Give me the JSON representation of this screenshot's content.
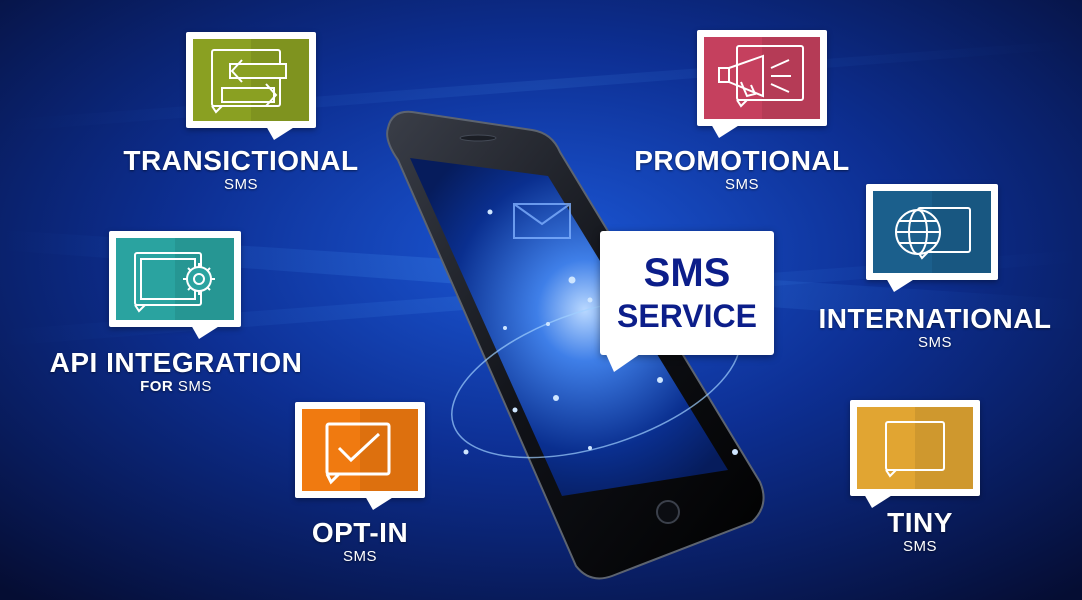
{
  "center": {
    "title_line1": "SMS",
    "title_line2": "SERVICE"
  },
  "features": [
    {
      "name": "TRANSICTIONAL",
      "sub": "SMS",
      "color": "#8aa022",
      "icon": "transfer-arrows-icon"
    },
    {
      "name": "PROMOTIONAL",
      "sub": "SMS",
      "color": "#c5405e",
      "icon": "megaphone-icon"
    },
    {
      "name": "API INTEGRATION",
      "sub_bold": "FOR",
      "sub": "SMS",
      "color": "#2aa3a0",
      "icon": "api-gear-icon"
    },
    {
      "name": "INTERNATIONAL",
      "sub": "SMS",
      "color": "#1b5f8c",
      "icon": "globe-icon"
    },
    {
      "name": "OPT-IN",
      "sub": "SMS",
      "color": "#f07a10",
      "icon": "checkmark-icon"
    },
    {
      "name": "TINY",
      "sub": "SMS",
      "color": "#e1a532",
      "icon": "chat-bubble-icon"
    }
  ],
  "colors": {
    "background_dark": "#07133f",
    "background_mid": "#0f3aa0",
    "accent_text": "#0c1e8a"
  }
}
